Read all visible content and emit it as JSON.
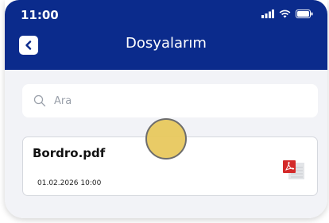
{
  "status_bar": {
    "time": "11:00"
  },
  "header": {
    "title": "Dosyalarım"
  },
  "search": {
    "placeholder": "Ara"
  },
  "files": [
    {
      "name": "Bordro.pdf",
      "date": "01.02.2026 10:00",
      "icon": "pdf-icon"
    }
  ],
  "colors": {
    "header": "#0b2b8c",
    "content_bg": "#f2f3f7",
    "pdf_red": "#d42a2a",
    "tap": "#e8c95e"
  }
}
